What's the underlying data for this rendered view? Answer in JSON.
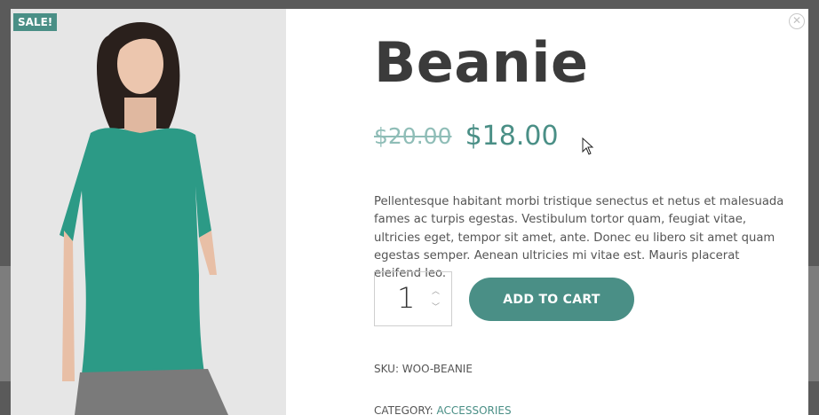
{
  "modal": {
    "sale_badge": "SALE!",
    "close_glyph": "✕",
    "product": {
      "title": "Beanie",
      "price_old": "$20.00",
      "price_new": "$18.00",
      "description": "Pellentesque habitant morbi tristique senectus et netus et malesuada fames ac turpis egestas. Vestibulum tortor quam, feugiat vitae, ultricies eget, tempor sit amet, ante. Donec eu libero sit amet quam egestas semper. Aenean ultricies mi vitae est. Mauris placerat eleifend leo.",
      "quantity": "1",
      "add_to_cart_label": "ADD TO CART",
      "sku": "SKU: WOO-BEANIE",
      "category_label": "CATEGORY:",
      "category_link": "ACCESSORIES"
    },
    "icons": {
      "qty_up": "chevron-up-icon",
      "qty_down": "chevron-down-icon",
      "close": "close-icon"
    },
    "colors": {
      "accent": "#4a8f86",
      "shirt": "#2c9a86",
      "image_bg": "#e4e4e4"
    }
  }
}
